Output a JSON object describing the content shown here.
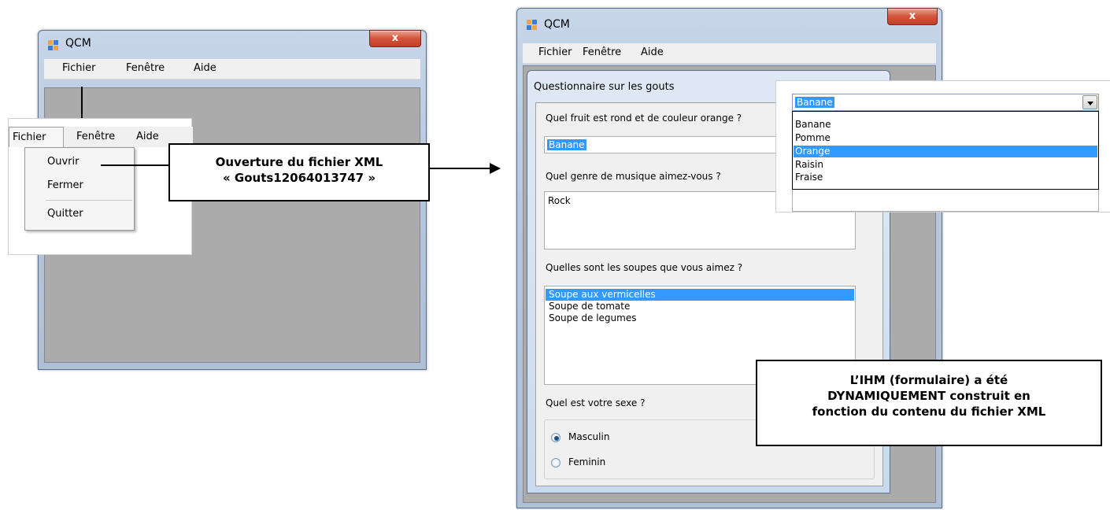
{
  "left_window": {
    "title": "QCM",
    "close_glyph": "x",
    "menu": [
      "Fichier",
      "Fenêtre",
      "Aide"
    ]
  },
  "menu_popup": {
    "menubar": [
      "Fichier",
      "Fenêtre",
      "Aide"
    ],
    "items": [
      "Ouvrir",
      "Fermer",
      "Quitter"
    ]
  },
  "callout_open": {
    "line1": "Ouverture du fichier XML",
    "line2": "« Gouts12064013747 »"
  },
  "right_window": {
    "title": "QCM",
    "close_glyph": "x",
    "menu": [
      "Fichier",
      "Fenêtre",
      "Aide"
    ],
    "form_title": "Questionnaire sur les gouts",
    "q1": {
      "label": "Quel fruit est rond et de couleur orange ?",
      "value": "Banane"
    },
    "q2": {
      "label": "Quel genre de musique aimez-vous ?",
      "value": "Rock"
    },
    "q3": {
      "label": "Quelles sont les soupes que vous aimez ?",
      "options": [
        "Soupe aux vermicelles",
        "Soupe de tomate",
        "Soupe de legumes"
      ],
      "selected": 0
    },
    "q4": {
      "label": "Quel est votre sexe ?",
      "options": [
        "Masculin",
        "Feminin"
      ],
      "selected": 0
    }
  },
  "combo_popup": {
    "value": "Banane",
    "options": [
      "Banane",
      "Pomme",
      "Orange",
      "Raisin",
      "Fraise"
    ],
    "highlighted": 2
  },
  "callout_ihm": {
    "line1": "L’IHM (formulaire) a été",
    "line2": "DYNAMIQUEMENT construit en",
    "line3": "fonction du contenu du fichier XML"
  }
}
